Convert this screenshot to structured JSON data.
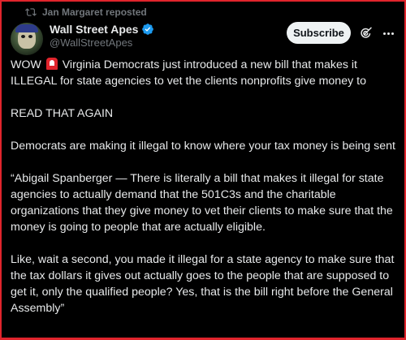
{
  "repost": {
    "text": "Jan Margaret reposted"
  },
  "author": {
    "name": "Wall Street Apes",
    "handle": "@WallStreetApes"
  },
  "actions": {
    "subscribe_label": "Subscribe"
  },
  "post": {
    "p1_before": "WOW ",
    "p1_after": " Virginia Democrats just introduced a new bill that makes it ILLEGAL for state agencies to vet the clients nonprofits give money to",
    "p2": "READ THAT AGAIN",
    "p3": "Democrats are making it illegal to know where your tax money is being sent",
    "p4": "“Abigail Spanberger — There is literally a bill that makes it illegal for state agencies to actually demand that the 501C3s and the charitable organizations that they give money to vet their clients to make sure that the money is going to people that are actually eligible.",
    "p5": "Like, wait a second, you made it illegal for a state agency to make sure that the tax dollars it gives out actually goes to the people that are supposed to get it, only the qualified people? Yes, that is the bill right before the General Assembly”"
  },
  "colors": {
    "background": "#000000",
    "text": "#e7e9ea",
    "secondary": "#71767b",
    "verified": "#1d9bf0",
    "frame": "#e0242c"
  },
  "icons": {
    "repost": "repost-icon",
    "verified": "verified-badge-icon",
    "grok": "grok-icon",
    "more": "more-icon",
    "siren": "siren-emoji"
  }
}
